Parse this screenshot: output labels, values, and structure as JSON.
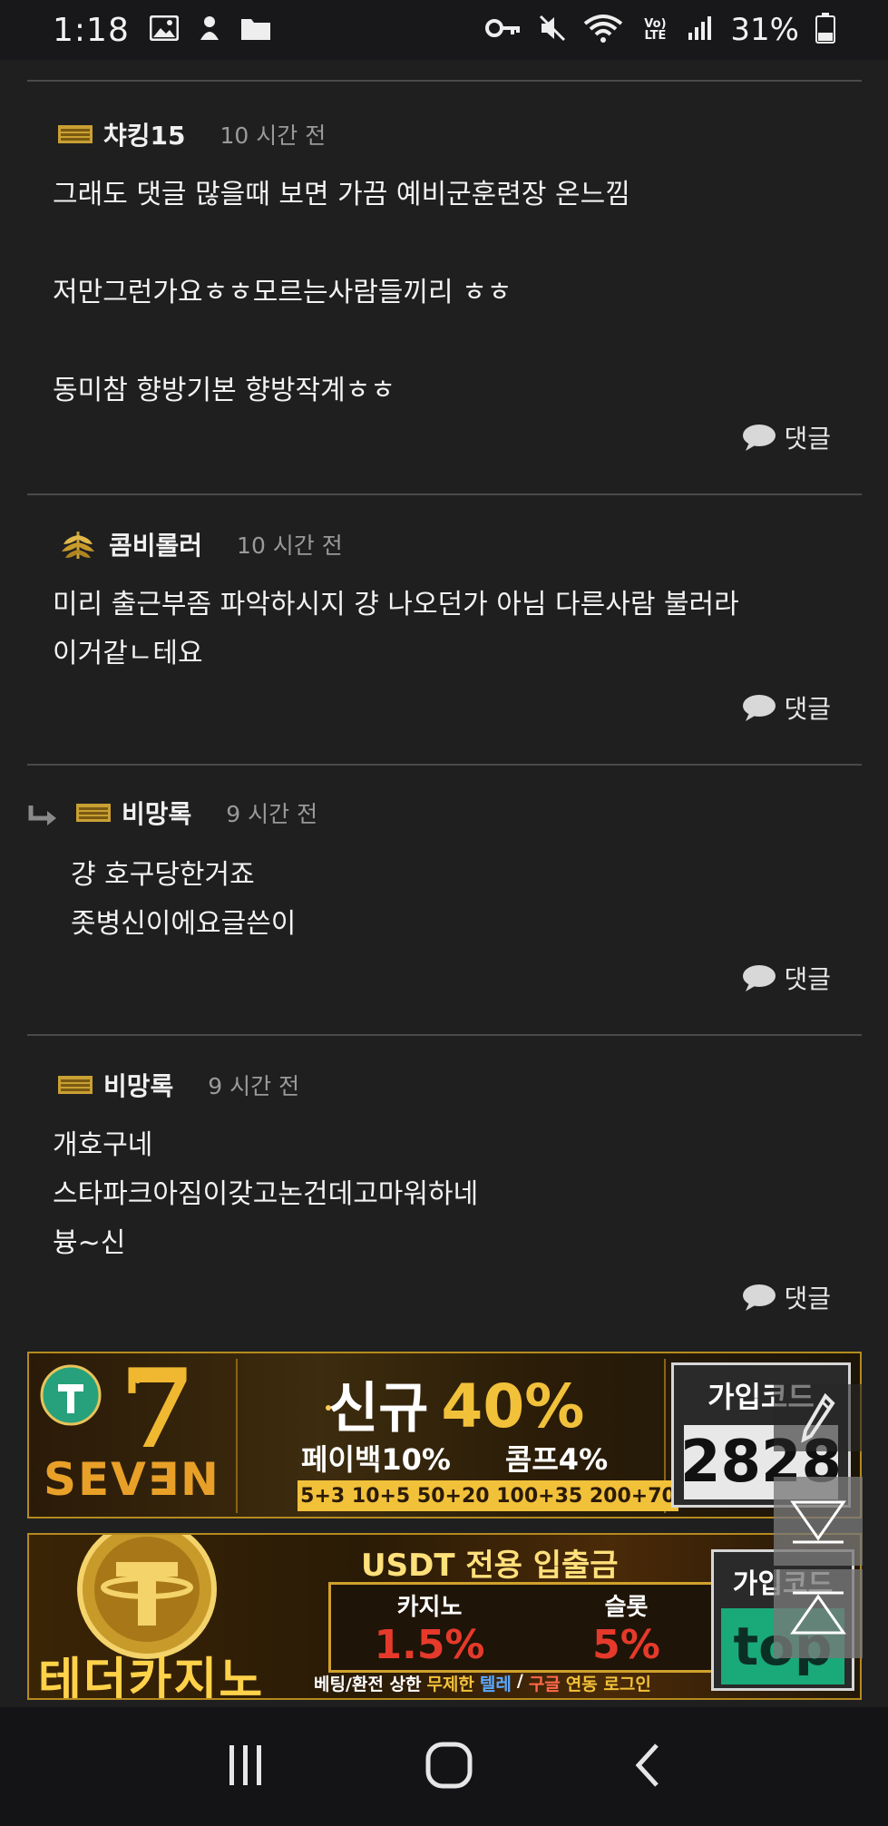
{
  "status_bar": {
    "time": "1:18",
    "battery_percent": "31%",
    "volte_label": "Vo) LTE"
  },
  "comments": [
    {
      "author": "챠킹15",
      "time": "10 시간 전",
      "rank_icon": "rank-bar-icon",
      "body": "그래도 댓글 많을때 보면 가끔 예비군훈련장 온느낌\n\n저만그런가요ㅎㅎ모르는사람들끼리 ㅎㅎ\n\n동미참 향방기본 향방작계ㅎㅎ",
      "reply_label": "댓글"
    },
    {
      "author": "콤비롤러",
      "time": "10 시간 전",
      "rank_icon": "rank-wheat-icon",
      "body": "미리 출근부좀 파악하시지 걍 나오던가 아님 다른사람 불러라\n이거같ㄴ테요",
      "reply_label": "댓글"
    },
    {
      "author": "비망록",
      "time": "9 시간 전",
      "rank_icon": "rank-bar-icon",
      "is_reply": true,
      "body": "걍 호구당한거죠\n좃병신이에요글쓴이",
      "reply_label": "댓글"
    },
    {
      "author": "비망록",
      "time": "9 시간 전",
      "rank_icon": "rank-bar-icon",
      "body": "개호구네\n스타파크아짐이갖고논건데고마워하네\n븅~신",
      "reply_label": "댓글"
    }
  ],
  "banner1": {
    "brand": "SEV∃N",
    "big_number": "7",
    "headline_a": "신규",
    "headline_b": "40%",
    "sub_a": "페이백10%",
    "sub_b": "콤프4%",
    "bonus_line": "5+3 10+5 50+20 100+35 200+70",
    "code_label": "가입코드",
    "code_value": "2828"
  },
  "banner2": {
    "brand": "테더카지노",
    "headline": "USDT 전용 입출금",
    "casino_label": "카지노",
    "casino_value": "1.5%",
    "slot_label": "슬롯",
    "slot_value": "5%",
    "footer_a": "베팅/환전 상한",
    "footer_b": "무제한",
    "footer_c": "텔레",
    "footer_d": "구글",
    "footer_e": "연동 로그인",
    "code_label": "가입코드",
    "code_value": "top"
  },
  "colors": {
    "background": "#1f1f20",
    "divider": "#4a4a4c",
    "gold": "#f2c13a",
    "time_gray": "#9a9a9a"
  }
}
